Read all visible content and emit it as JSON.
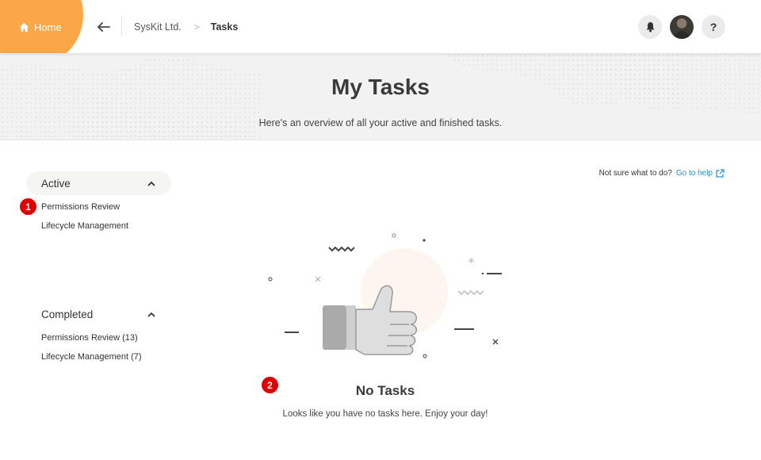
{
  "header": {
    "home_label": "Home",
    "breadcrumb": {
      "parent": "SysKit Ltd.",
      "separator": ">",
      "current": "Tasks"
    },
    "help_label": "?"
  },
  "hero": {
    "title": "My Tasks",
    "subtitle": "Here's an overview of all your active and finished tasks."
  },
  "sidebar": {
    "active": {
      "label": "Active",
      "items": [
        {
          "label": "Permissions Review"
        },
        {
          "label": "Lifecycle Management"
        }
      ]
    },
    "completed": {
      "label": "Completed",
      "items": [
        {
          "label": "Permissions Review (13)"
        },
        {
          "label": "Lifecycle Management (7)"
        }
      ]
    }
  },
  "help": {
    "question": "Not sure what to do?",
    "link": "Go to help"
  },
  "empty_state": {
    "title": "No Tasks",
    "text": "Looks like you have no tasks here. Enjoy your day!"
  },
  "markers": [
    "1",
    "2"
  ],
  "colors": {
    "accent": "#fba748",
    "link": "#2a8fd6",
    "marker": "#e10000"
  }
}
